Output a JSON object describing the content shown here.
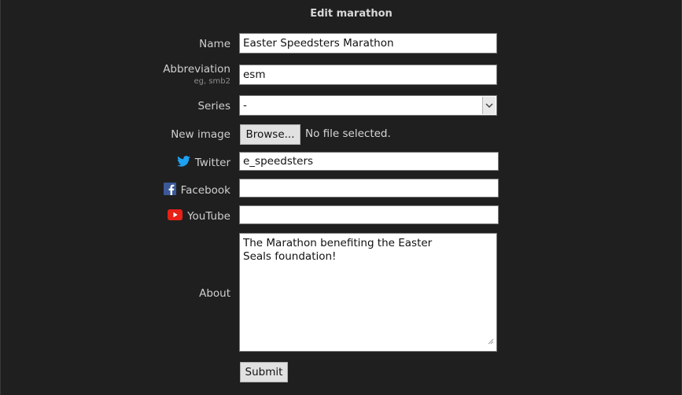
{
  "title": "Edit marathon",
  "fields": {
    "name": {
      "label": "Name",
      "value": "Easter Speedsters Marathon"
    },
    "abbreviation": {
      "label": "Abbreviation",
      "hint": "eg, smb2",
      "value": "esm"
    },
    "series": {
      "label": "Series",
      "selected": "-"
    },
    "image": {
      "label": "New image",
      "button": "Browse...",
      "status": "No file selected."
    },
    "twitter": {
      "label": "Twitter",
      "value": "e_speedsters",
      "icon": "twitter-icon"
    },
    "facebook": {
      "label": "Facebook",
      "value": "",
      "icon": "facebook-icon"
    },
    "youtube": {
      "label": "YouTube",
      "value": "",
      "icon": "youtube-icon"
    },
    "about": {
      "label": "About",
      "value": "The Marathon benefiting the Easter Seals foundation!"
    }
  },
  "submit_label": "Submit",
  "colors": {
    "background": "#1f1f1f",
    "twitter": "#1da1f2",
    "facebook": "#3b5998",
    "youtube": "#e62117"
  }
}
